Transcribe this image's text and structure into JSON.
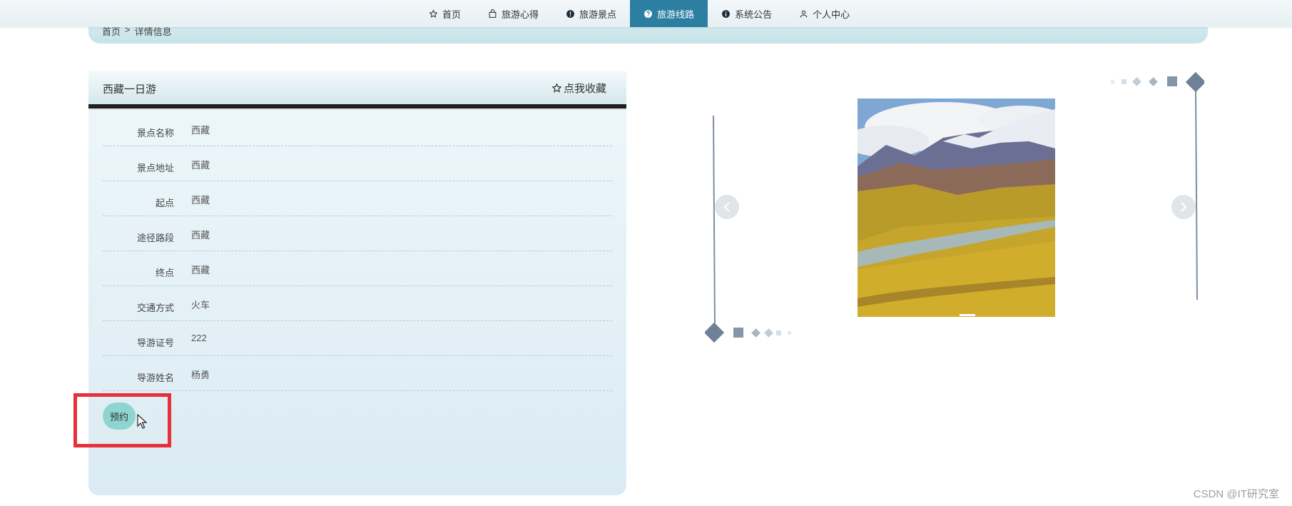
{
  "nav": {
    "items": [
      {
        "label": "首页",
        "icon": "star-outline-icon"
      },
      {
        "label": "旅游心得",
        "icon": "bag-icon"
      },
      {
        "label": "旅游景点",
        "icon": "info-icon"
      },
      {
        "label": "旅游线路",
        "icon": "question-icon",
        "active": true
      },
      {
        "label": "系统公告",
        "icon": "info-icon"
      },
      {
        "label": "个人中心",
        "icon": "user-icon"
      }
    ]
  },
  "breadcrumb": {
    "home": "首页",
    "sep": ">",
    "current": "详情信息"
  },
  "detail": {
    "title": "西藏一日游",
    "favorite_label": "点我收藏",
    "fields": [
      {
        "label": "景点名称",
        "value": "西藏"
      },
      {
        "label": "景点地址",
        "value": "西藏"
      },
      {
        "label": "起点",
        "value": "西藏"
      },
      {
        "label": "途径路段",
        "value": "西藏"
      },
      {
        "label": "终点",
        "value": "西藏"
      },
      {
        "label": "交通方式",
        "value": "火车"
      },
      {
        "label": "导游证号",
        "value": "222"
      },
      {
        "label": "导游姓名",
        "value": "杨勇"
      }
    ],
    "book_button": "预约"
  },
  "carousel": {
    "prev_icon": "chevron-left-icon",
    "next_icon": "chevron-right-icon",
    "image": "mountain-landscape-photo"
  },
  "watermark": "CSDN @IT研究室",
  "colors": {
    "nav_active": "#2d7fa1",
    "book_button": "#8ed4cf",
    "highlight": "#e8303a"
  }
}
